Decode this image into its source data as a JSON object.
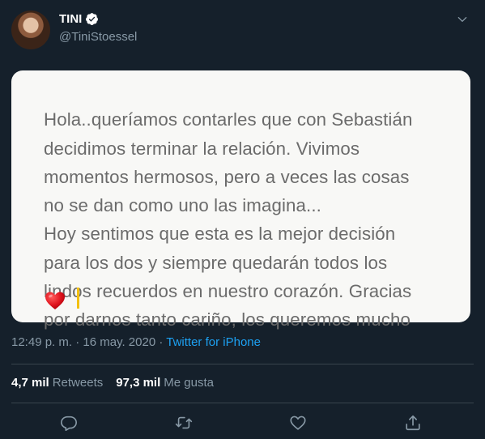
{
  "author": {
    "name": "TINI",
    "handle": "@TiniStoessel"
  },
  "media": {
    "text": "Hola..queríamos contarles que con Sebastián\ndecidimos terminar la relación. Vivimos\nmomentos hermosos, pero a veces las cosas\nno se dan como uno las imagina...\nHoy sentimos que esta es la mejor decisión\npara los dos y siempre quedarán todos los\nlindos recuerdos en nuestro corazón. Gracias\npor darnos tanto cariño, los queremos mucho",
    "emoji": "heart-emoji"
  },
  "meta": {
    "time": "12:49 p. m.",
    "separator": "·",
    "date": "16 may. 2020",
    "source": "Twitter for iPhone"
  },
  "stats": {
    "retweets_count": "4,7 mil",
    "retweets_label": "Retweets",
    "likes_count": "97,3 mil",
    "likes_label": "Me gusta"
  },
  "colors": {
    "background": "#15202b",
    "secondary_text": "#8899a6",
    "accent": "#1da1f2",
    "divider": "#38444d",
    "verified": "#ffffff"
  },
  "icons": [
    "verified-badge-icon",
    "caret-down-icon",
    "reply-icon",
    "retweet-icon",
    "like-icon",
    "share-icon"
  ]
}
